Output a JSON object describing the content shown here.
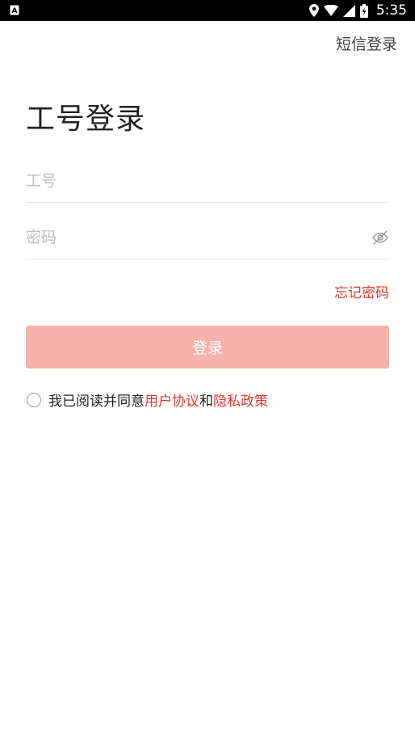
{
  "status_bar": {
    "time": "5:35",
    "icons": [
      "notification-a-icon",
      "location-icon",
      "wifi-icon",
      "signal-icon",
      "battery-charging-icon"
    ]
  },
  "header": {
    "sms_login": "短信登录"
  },
  "main": {
    "title": "工号登录",
    "employee_id": {
      "placeholder": "工号",
      "value": ""
    },
    "password": {
      "placeholder": "密码",
      "value": ""
    },
    "forgot_password": "忘记密码",
    "login_button": "登录"
  },
  "agreement": {
    "checked": false,
    "prefix": "我已阅读并同意",
    "user_agreement": "用户协议",
    "and": "和",
    "privacy_policy": "隐私政策"
  },
  "colors": {
    "accent": "#e53a2b",
    "button_disabled": "#f4b2aa",
    "status_bar": "#000000"
  }
}
